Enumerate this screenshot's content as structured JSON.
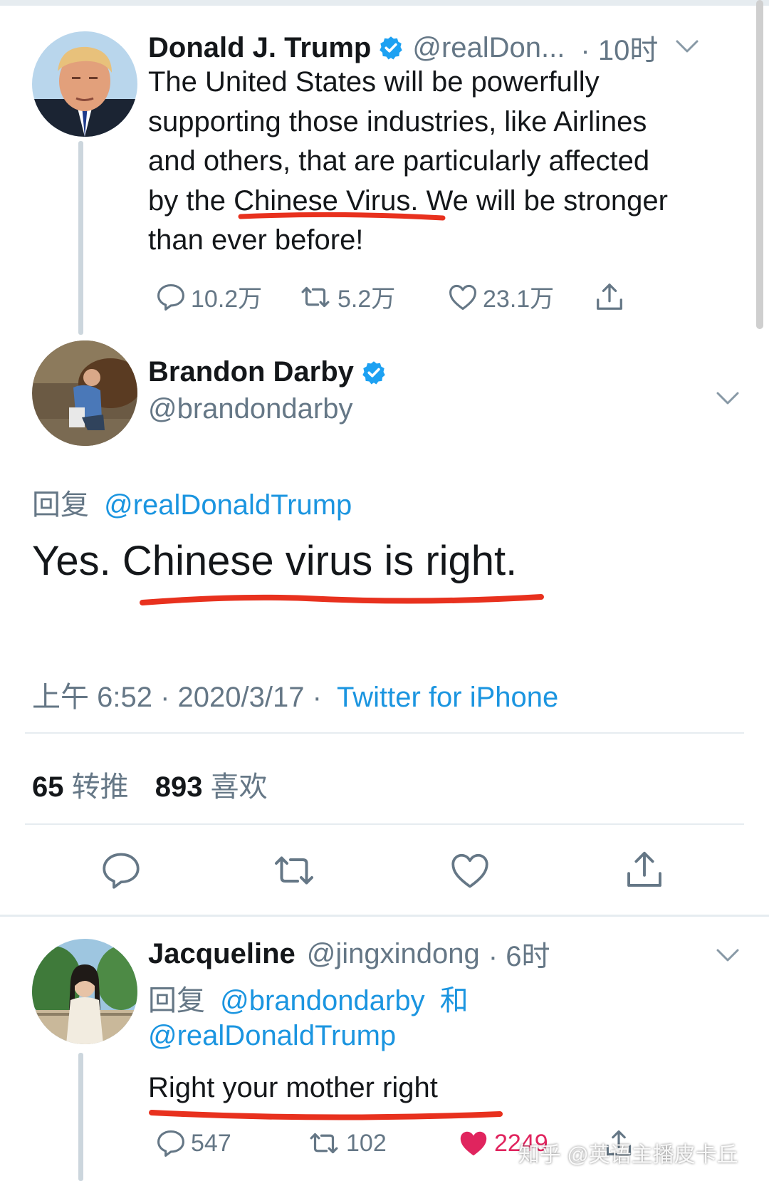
{
  "tweets": [
    {
      "name": "Donald J. Trump",
      "handle": "@realDon...",
      "time": "· 10时",
      "lines": [
        "The United States will be powerfully",
        "supporting those industries, like Airlines",
        "and others, that are particularly affected",
        "by the Chinese Virus. We will be stronger",
        "than ever before!"
      ],
      "replies": "10.2万",
      "retweets": "5.2万",
      "likes": "23.1万"
    }
  ],
  "focused": {
    "name": "Brandon Darby",
    "handle": "@brandondarby",
    "reply_prefix": "回复",
    "reply_target": "@realDonaldTrump",
    "text": "Yes. Chinese virus is right.",
    "time": "上午 6:52 · 2020/3/17 ·",
    "source": "Twitter for iPhone",
    "retweet_count": "65",
    "retweet_label": "转推",
    "like_count": "893",
    "like_label": "喜欢"
  },
  "reply": {
    "name": "Jacqueline",
    "handle": "@jingxindong",
    "time": "· 6时",
    "reply_prefix": "回复",
    "reply_target_1": "@brandondarby",
    "reply_joiner": "和",
    "reply_target_2": "@realDonaldTrump",
    "text": "Right your mother right",
    "replies": "547",
    "retweets": "102",
    "likes": "2249"
  },
  "watermark": "知乎 @英语主播皮卡丘",
  "colors": {
    "link": "#1b95e0",
    "secondary": "#657786",
    "like_active": "#e0245e",
    "annotation": "#e8311e"
  }
}
